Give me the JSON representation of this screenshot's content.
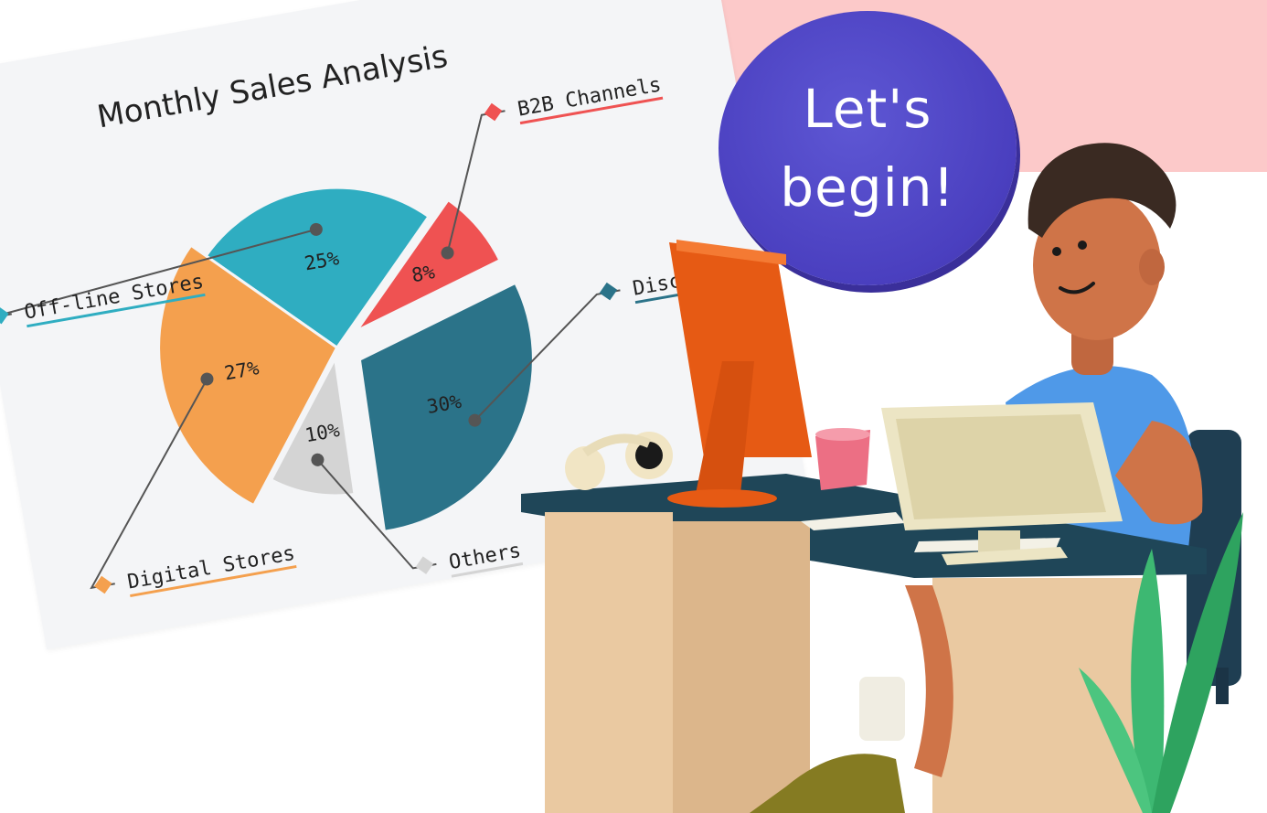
{
  "chart_data": {
    "type": "pie",
    "title": "Monthly Sales Analysis",
    "slices": [
      {
        "label": "Off-line Stores",
        "value": 25,
        "display": "25%",
        "color": "#2fadc1"
      },
      {
        "label": "B2B Channels",
        "value": 8,
        "display": "8%",
        "color": "#ef5252"
      },
      {
        "label": "Discounts Stores",
        "value": 30,
        "display": "30%",
        "color": "#2b7389"
      },
      {
        "label": "Others",
        "value": 10,
        "display": "10%",
        "color": "#d4d4d4"
      },
      {
        "label": "Digital Stores",
        "value": 27,
        "display": "27%",
        "color": "#f4a04e"
      }
    ],
    "legend": "callout labels",
    "grid": false
  },
  "bubble": {
    "line1": "Let's",
    "line2": "begin!"
  },
  "colors": {
    "banner": "#fcc9c9",
    "bubble": "#4a3fbf",
    "card": "#f4f5f7"
  },
  "illustration": {
    "subject": "person-at-desk-illustration",
    "icons": [
      "monitor-icon",
      "headphones-icon",
      "cup-icon",
      "plant-icon",
      "chair-icon"
    ]
  }
}
